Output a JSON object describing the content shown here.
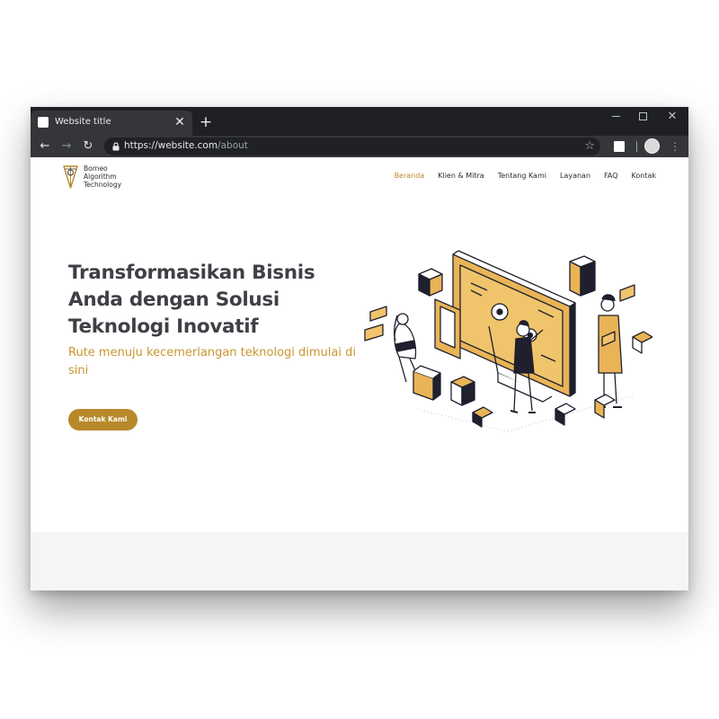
{
  "browser": {
    "tab_title": "Website title",
    "tab_close": "✕",
    "new_tab": "+",
    "url_host": "https://website.com",
    "url_path": "/about",
    "window_close": "✕",
    "nav_back": "←",
    "nav_forward": "→",
    "nav_reload": "↻",
    "bookmark": "☆",
    "menu": "⋮"
  },
  "site": {
    "logo_lines": [
      "Borneo",
      "Algorithm",
      "Technology"
    ],
    "nav_items": [
      {
        "label": "Beranda",
        "active": true
      },
      {
        "label": "Klien & Mitra",
        "active": false
      },
      {
        "label": "Tentang Kami",
        "active": false
      },
      {
        "label": "Layanan",
        "active": false
      },
      {
        "label": "FAQ",
        "active": false
      },
      {
        "label": "Kontak",
        "active": false
      }
    ]
  },
  "hero": {
    "title": "Transformasikan Bisnis Anda dengan Solusi Teknologi Inovatif",
    "subtitle": "Rute menuju kecemerlangan teknologi dimulai di sini",
    "cta_label": "Kontak Kami"
  },
  "colors": {
    "accent": "#b8892b",
    "chrome_dark": "#1f2023",
    "chrome_tab": "#35363a",
    "title_text": "#3f3f46"
  },
  "icons": {
    "favicon": "favicon-icon",
    "lock": "lock-icon",
    "bookmark": "star-icon",
    "extension": "extension-icon",
    "profile": "profile-icon",
    "menu": "menu-icon"
  }
}
